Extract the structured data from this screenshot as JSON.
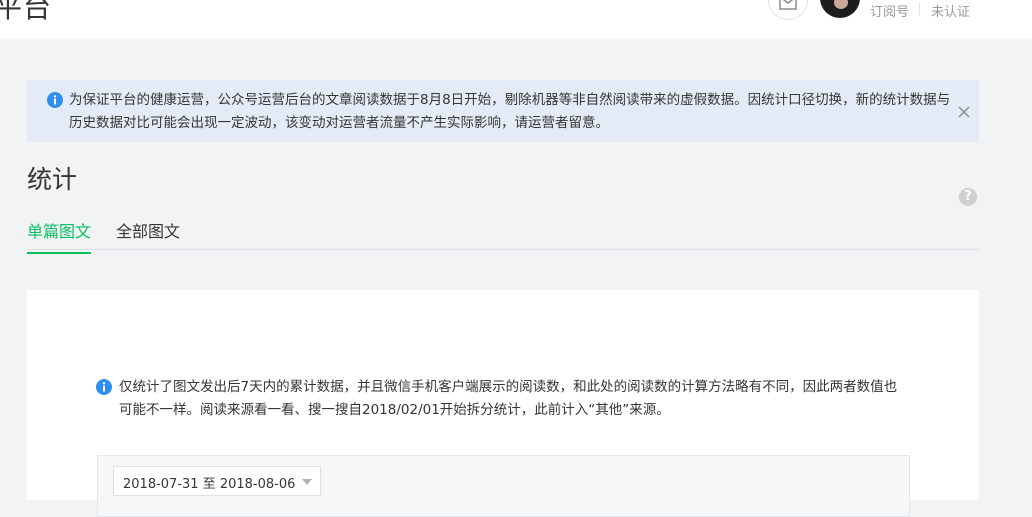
{
  "header": {
    "brand_text": "平台",
    "account_type": "订阅号",
    "verify_status": "未认证"
  },
  "notice": {
    "text": "为保证平台的健康运营，公众号运营后台的文章阅读数据于8月8日开始，剔除机器等非自然阅读带来的虚假数据。因统计口径切换，新的统计数据与历史数据对比可能会出现一定波动，该变动对运营者流量不产生实际影响，请运营者留意。"
  },
  "page": {
    "title": "统计",
    "help_glyph": "?"
  },
  "tabs": [
    {
      "label": "单篇图文",
      "active": true
    },
    {
      "label": "全部图文",
      "active": false
    }
  ],
  "tip": {
    "text": "仅统计了图文发出后7天内的累计数据，并且微信手机客户端展示的阅读数，和此处的阅读数的计算方法略有不同，因此两者数值也可能不一样。阅读来源看一看、搜一搜自2018/02/01开始拆分统计，此前计入“其他”来源。"
  },
  "filter": {
    "date_range": "2018-07-31 至 2018-08-06"
  },
  "colors": {
    "accent_green": "#07c160",
    "info_blue": "#2e8ff0",
    "notice_bg": "#e4ebf6"
  },
  "icons": {
    "notice": "info-icon",
    "close": "close-icon",
    "mail": "mail-icon",
    "help": "question-icon"
  }
}
